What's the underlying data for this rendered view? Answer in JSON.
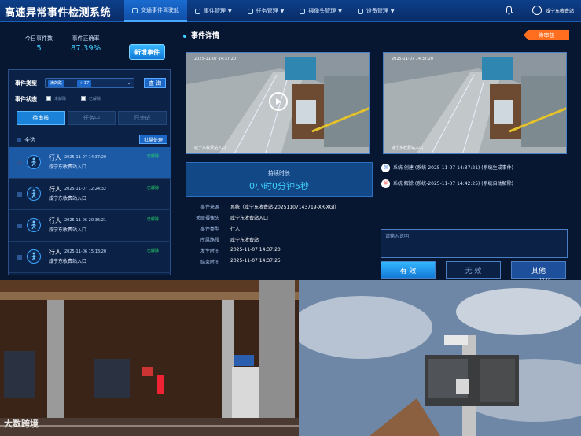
{
  "app": {
    "title": "高速异常事件检测系统"
  },
  "nav": [
    {
      "label": "交通事件驾驶舱",
      "active": true
    },
    {
      "label": "事件管理",
      "caret": true
    },
    {
      "label": "任务管理",
      "caret": true
    },
    {
      "label": "摄像头管理",
      "caret": true
    },
    {
      "label": "设备管理",
      "caret": true
    }
  ],
  "user": {
    "name": "咸宁东收费站"
  },
  "stats": {
    "today_label": "今日事件数",
    "today_value": "5",
    "accuracy_label": "事件正确率",
    "accuracy_value": "87.39%"
  },
  "new_event_button": "新增事件",
  "filter": {
    "type_label": "事件类型",
    "type_chip": "满的路",
    "type_more": "+ 17",
    "query_button": "查 询",
    "status_label": "事件状态",
    "opt_unresolved": "未解除",
    "opt_resolved": "已解除"
  },
  "tabs": [
    {
      "label": "待审核",
      "active": true
    },
    {
      "label": "任务中"
    },
    {
      "label": "已完成"
    }
  ],
  "select_all": "全选",
  "batch_button": "批量处理",
  "events": [
    {
      "type": "行人",
      "time": "2025-11-07 14:37:20",
      "location": "咸宁东收费站入口",
      "status": "已解除",
      "selected": true
    },
    {
      "type": "行人",
      "time": "2025-11-07 12:24:32",
      "location": "咸宁东收费站入口",
      "status": "已解除"
    },
    {
      "type": "行人",
      "time": "2025-11-06 20:36:21",
      "location": "咸宁东收费站入口",
      "status": "已解除"
    },
    {
      "type": "行人",
      "time": "2025-11-06 15:13:20",
      "location": "咸宁东收费站入口",
      "status": "已解除"
    }
  ],
  "detail": {
    "title": "事件详情",
    "badge": "待审核",
    "cam1": {
      "timestamp": "2025-11-07 14:37:20",
      "label": "咸宁东收费站入口"
    },
    "cam2": {
      "timestamp": "2025-11-07 14:37:20",
      "label": "咸宁东收费站入口"
    },
    "duration_label": "持续时长",
    "duration_value": "0小时0分钟5秒",
    "fields": [
      {
        "key": "事件来源",
        "value": "系统（咸宁东收费站-20251107143719-XR-XGJ）"
      },
      {
        "key": "关联摄像头",
        "value": "咸宁东收费站入口"
      },
      {
        "key": "事件类型",
        "value": "行人"
      },
      {
        "key": "所属路段",
        "value": "咸宁东收费站"
      },
      {
        "key": "发生时间",
        "value": "2025-11-07 14:37:20"
      },
      {
        "key": "结束时间",
        "value": "2025-11-07 14:37:25"
      }
    ],
    "logs": [
      {
        "icon": "创",
        "text": "系统 创建 (系统-2025-11-07 14:37:21) (系统生成事件)"
      },
      {
        "icon": "解",
        "text": "系统 解除 (系统-2025-11-07 14:42:25) (系统自动解除)"
      }
    ],
    "note_placeholder": "请输入说明",
    "btn_valid": "有 效",
    "btn_invalid": "无 效",
    "btn_other": "其他"
  },
  "clock_stub": "13:10",
  "watermark": "大数跨境",
  "colors": {
    "accent": "#3fd0ff",
    "primary": "#1b67c6",
    "badge": "#ff6e1f",
    "resolved": "#27d86a"
  }
}
